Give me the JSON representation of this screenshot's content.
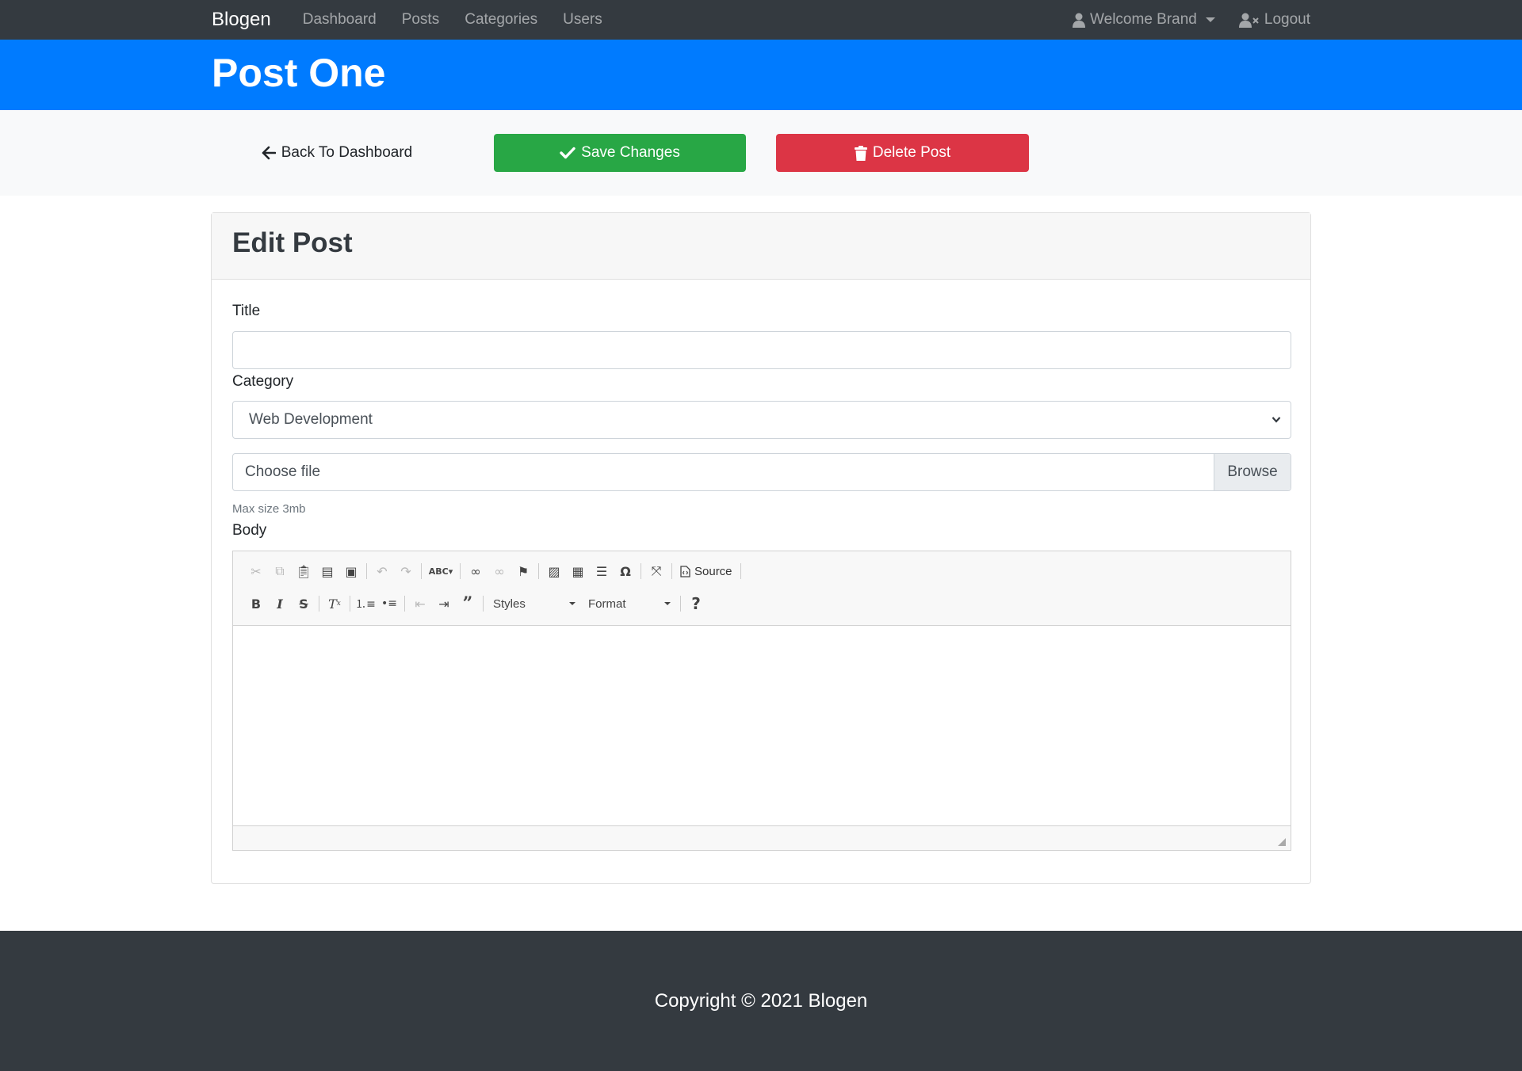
{
  "navbar": {
    "brand": "Blogen",
    "links": [
      "Dashboard",
      "Posts",
      "Categories",
      "Users"
    ],
    "user_menu": "Welcome Brand",
    "logout": "Logout"
  },
  "header": {
    "title": "Post One"
  },
  "actions": {
    "back_label": "Back To Dashboard",
    "save_label": "Save Changes",
    "delete_label": "Delete Post"
  },
  "card": {
    "heading": "Edit Post",
    "title_label": "Title",
    "title_value": "",
    "category_label": "Category",
    "category_selected": "Web Development",
    "file_placeholder": "Choose file",
    "browse_label": "Browse",
    "file_hint": "Max size 3mb",
    "body_label": "Body"
  },
  "editor": {
    "source_label": "Source",
    "styles_label": "Styles",
    "format_label": "Format",
    "row1_icons": [
      "cut-icon",
      "copy-icon",
      "paste-icon",
      "paste-text-icon",
      "paste-word-icon",
      "undo-icon",
      "redo-icon",
      "spellcheck-icon",
      "link-icon",
      "unlink-icon",
      "anchor-icon",
      "image-icon",
      "table-icon",
      "horizontal-line-icon",
      "special-char-icon",
      "maximize-icon",
      "source-icon"
    ],
    "row2_icons": [
      "bold-icon",
      "italic-icon",
      "strikethrough-icon",
      "remove-format-icon",
      "numbered-list-icon",
      "bulleted-list-icon",
      "outdent-icon",
      "indent-icon",
      "blockquote-icon",
      "help-icon"
    ]
  },
  "colors": {
    "navbar": "#343a40",
    "header": "#007bff",
    "save": "#28a745",
    "delete": "#dc3545",
    "footer": "#343a40"
  },
  "footer": {
    "copyright": "Copyright © 2021 Blogen"
  }
}
